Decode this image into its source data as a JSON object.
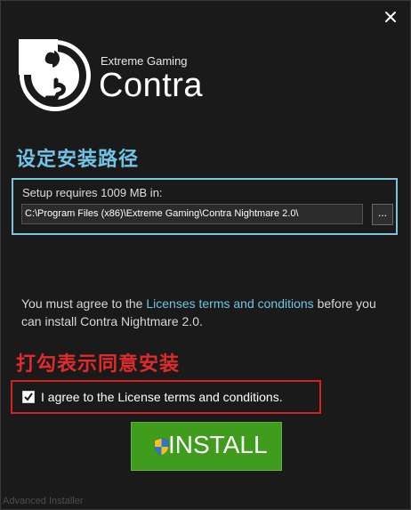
{
  "header": {
    "brand_sub": "Extreme Gaming",
    "brand_title": "Contra",
    "logo_icon": "puzzle-c-logo-icon",
    "close_icon": "close-icon"
  },
  "install_path": {
    "section_title": "设定安装路径",
    "label": "Setup requires 1009 MB in:",
    "value": "C:\\Program Files (x86)\\Extreme Gaming\\Contra Nightmare 2.0\\",
    "browse_label": "..."
  },
  "license": {
    "text_before": "You must agree to the ",
    "link_text": "Licenses terms and conditions",
    "text_after": " before you can install Contra Nightmare 2.0."
  },
  "agree": {
    "section_title": "打勾表示同意安装",
    "checkbox_label": "I agree to the License terms and conditions.",
    "checked": true
  },
  "install_button": {
    "label": "INSTALL",
    "icon": "uac-shield-icon"
  },
  "footer": {
    "text": "Advanced Installer"
  },
  "colors": {
    "background": "#1a1a1a",
    "accent_blue": "#71c4e6",
    "highlight_red": "#d42222",
    "install_green": "#409c1c"
  }
}
